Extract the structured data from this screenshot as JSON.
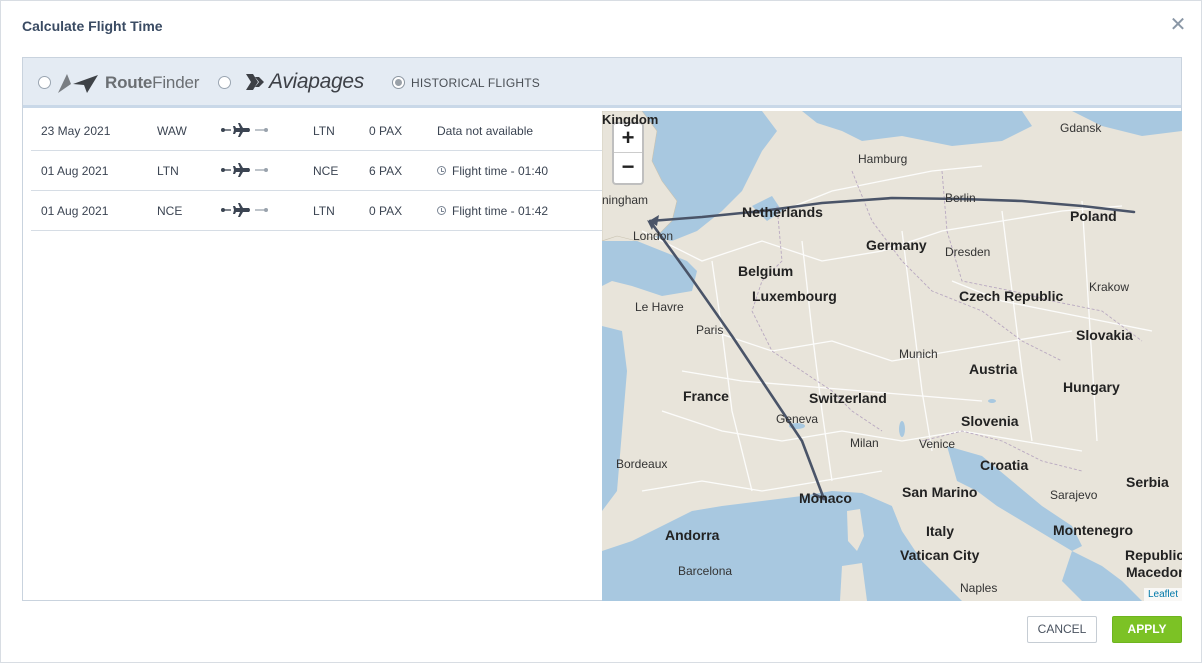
{
  "dialog": {
    "title": "Calculate Flight Time",
    "close_icon": "close-icon"
  },
  "sources": {
    "routefinder": {
      "name_bold": "Route",
      "name_thin": "Finder",
      "selected": false
    },
    "aviapages": {
      "name": "Aviapages",
      "selected": false
    },
    "historical": {
      "label": "HISTORICAL FLIGHTS",
      "selected": true
    }
  },
  "flights": [
    {
      "date": "23 May 2021",
      "from": "WAW",
      "to": "LTN",
      "pax": "0 PAX",
      "info": "Data not available",
      "has_time": false
    },
    {
      "date": "01 Aug 2021",
      "from": "LTN",
      "to": "NCE",
      "pax": "6 PAX",
      "info": "Flight time - 01:40",
      "has_time": true
    },
    {
      "date": "01 Aug 2021",
      "from": "NCE",
      "to": "LTN",
      "pax": "0 PAX",
      "info": "Flight time - 01:42",
      "has_time": true
    }
  ],
  "map": {
    "zoom_in": "+",
    "zoom_out": "−",
    "attribution": "Leaflet",
    "labels": {
      "kingdom": "Kingdom",
      "gdansk": "Gdansk",
      "hamburg": "Hamburg",
      "birmingham": "ningham",
      "berlin": "Berlin",
      "netherlands": "Netherlands",
      "poland": "Poland",
      "london": "London",
      "germany": "Germany",
      "dresden": "Dresden",
      "belgium": "Belgium",
      "krakow": "Krakow",
      "luxembourg": "Luxembourg",
      "czech": "Czech Republic",
      "lehavre": "Le Havre",
      "paris": "Paris",
      "slovakia": "Slovakia",
      "munich": "Munich",
      "austria": "Austria",
      "france": "France",
      "hungary": "Hungary",
      "switzerland": "Switzerland",
      "geneva": "Geneva",
      "slovenia": "Slovenia",
      "milan": "Milan",
      "venice": "Venice",
      "bordeaux": "Bordeaux",
      "croatia": "Croatia",
      "serbia": "Serbia",
      "monaco": "Monaco",
      "sanmarino": "San Marino",
      "sarajevo": "Sarajevo",
      "italy": "Italy",
      "montenegro": "Montenegro",
      "andorra": "Andorra",
      "vatican": "Vatican City",
      "republic": "Republic o",
      "macedonia": "Macedoni",
      "barcelona": "Barcelona",
      "naples": "Naples"
    }
  },
  "buttons": {
    "cancel": "CANCEL",
    "apply": "APPLY"
  },
  "colors": {
    "accent_green": "#7cc225",
    "route_line": "#4a5468",
    "water": "#a8c8e0"
  }
}
